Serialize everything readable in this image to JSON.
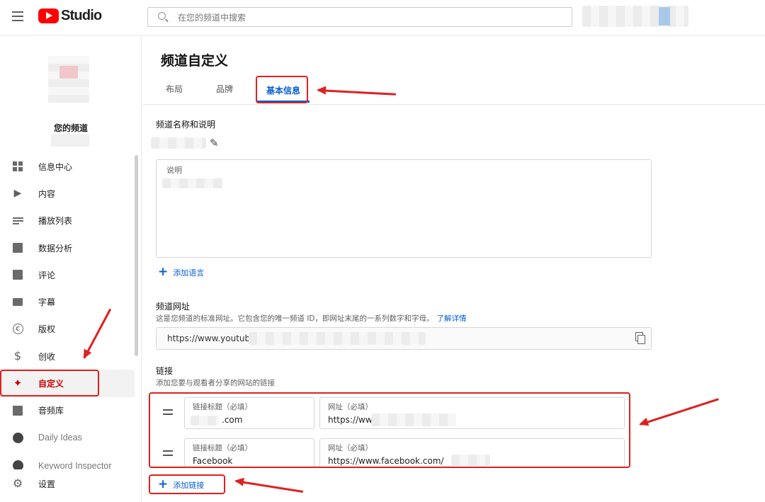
{
  "header": {
    "logo_text": "Studio",
    "search_placeholder": "在您的频道中搜索"
  },
  "sidebar": {
    "channel_label": "您的频道",
    "items": [
      {
        "label": "信息中心",
        "icon": "dashboard-icon"
      },
      {
        "label": "内容",
        "icon": "content-icon"
      },
      {
        "label": "播放列表",
        "icon": "playlist-icon"
      },
      {
        "label": "数据分析",
        "icon": "analytics-icon"
      },
      {
        "label": "评论",
        "icon": "comments-icon"
      },
      {
        "label": "字幕",
        "icon": "subtitles-icon"
      },
      {
        "label": "版权",
        "icon": "copyright-icon"
      },
      {
        "label": "创收",
        "icon": "dollar-icon"
      },
      {
        "label": "自定义",
        "icon": "magic-wand-icon",
        "active": true
      },
      {
        "label": "音频库",
        "icon": "audio-library-icon"
      },
      {
        "label": "Daily Ideas",
        "icon": "extension-icon"
      },
      {
        "label": "Keyword Inspector",
        "icon": "extension-icon"
      }
    ],
    "settings_label": "设置"
  },
  "main": {
    "title": "频道自定义",
    "tabs": [
      {
        "label": "布局"
      },
      {
        "label": "品牌"
      },
      {
        "label": "基本信息",
        "active": true
      }
    ],
    "name_section": {
      "title": "频道名称和说明",
      "description_label": "说明",
      "add_language": "添加语言"
    },
    "url_section": {
      "title": "频道网址",
      "desc": "这是您频道的标准网址。它包含您的唯一频道 ID，即网址末尾的一系列数字和字母。",
      "learn_more": "了解详情",
      "url_value": "https://www.youtube."
    },
    "links_section": {
      "title": "链接",
      "desc": "添加您要与观看者分享的网站的链接",
      "rows": [
        {
          "title_label": "链接标题（必填）",
          "title_value": ".com",
          "url_label": "网址（必填）",
          "url_value": "https://ww"
        },
        {
          "title_label": "链接标题（必填）",
          "title_value": "Facebook",
          "url_label": "网址（必填）",
          "url_value": "https://www.facebook.com/"
        }
      ],
      "add_link": "添加链接"
    }
  },
  "colors": {
    "accent": "#065fd4",
    "brand_red": "#ff0000",
    "annotation_red": "#e02020"
  }
}
